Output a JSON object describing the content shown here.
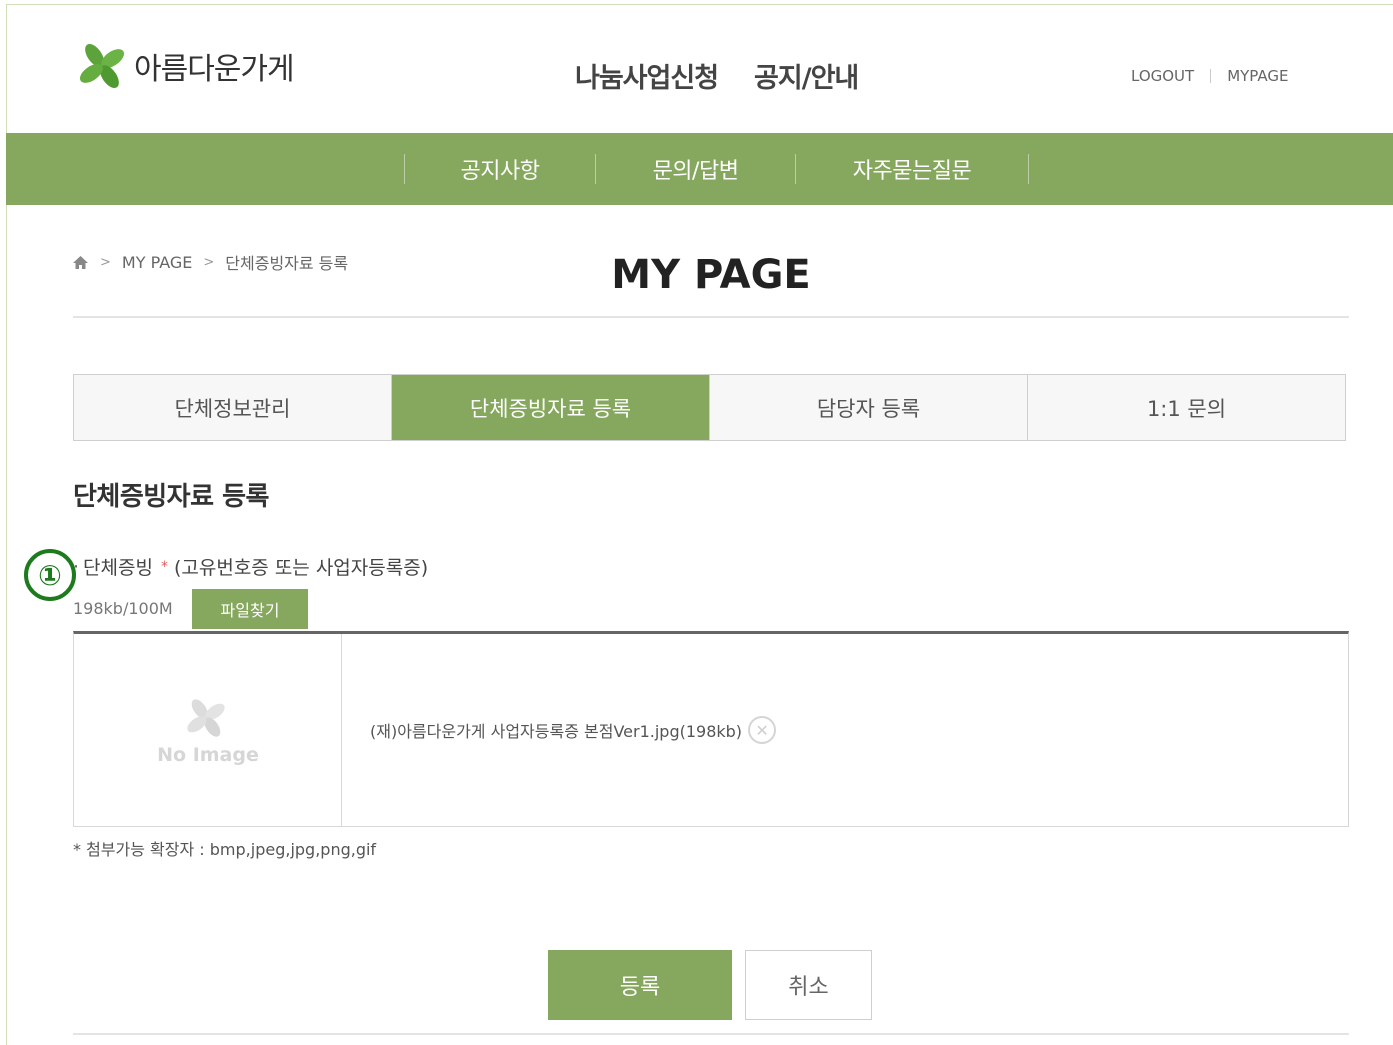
{
  "header": {
    "logo_text": "아름다운가게",
    "nav": [
      "나눔사업신청",
      "공지/안내"
    ],
    "util": {
      "logout": "LOGOUT",
      "mypage": "MYPAGE"
    }
  },
  "subnav": {
    "items": [
      "공지사항",
      "문의/답변",
      "자주묻는질문"
    ]
  },
  "breadcrumb": {
    "home_icon": "home-icon",
    "items": [
      "MY PAGE",
      "단체증빙자료 등록"
    ]
  },
  "page_title": "MY PAGE",
  "tabs": [
    {
      "label": "단체정보관리",
      "active": false
    },
    {
      "label": "단체증빙자료 등록",
      "active": true
    },
    {
      "label": "담당자 등록",
      "active": false
    },
    {
      "label": "1:1 문의",
      "active": false
    }
  ],
  "section": {
    "title": "단체증빙자료 등록",
    "step_badge": "①",
    "field_label": "단체증빙",
    "required_mark": "*",
    "field_hint": "(고유번호증 또는 사업자등록증)",
    "file_size": "198kb/100M",
    "find_button": "파일찾기",
    "thumbnail_text": "No Image",
    "file_name": "(재)아름다운가게 사업자등록증 본점Ver1.jpg(198kb)",
    "delete_symbol": "✕",
    "note": "* 첨부가능 확장자 : bmp,jpeg,jpg,png,gif"
  },
  "buttons": {
    "submit": "등록",
    "cancel": "취소"
  },
  "colors": {
    "brand_green": "#86a75e",
    "badge_green": "#1d7a1d",
    "required_red": "#e35d5d"
  }
}
